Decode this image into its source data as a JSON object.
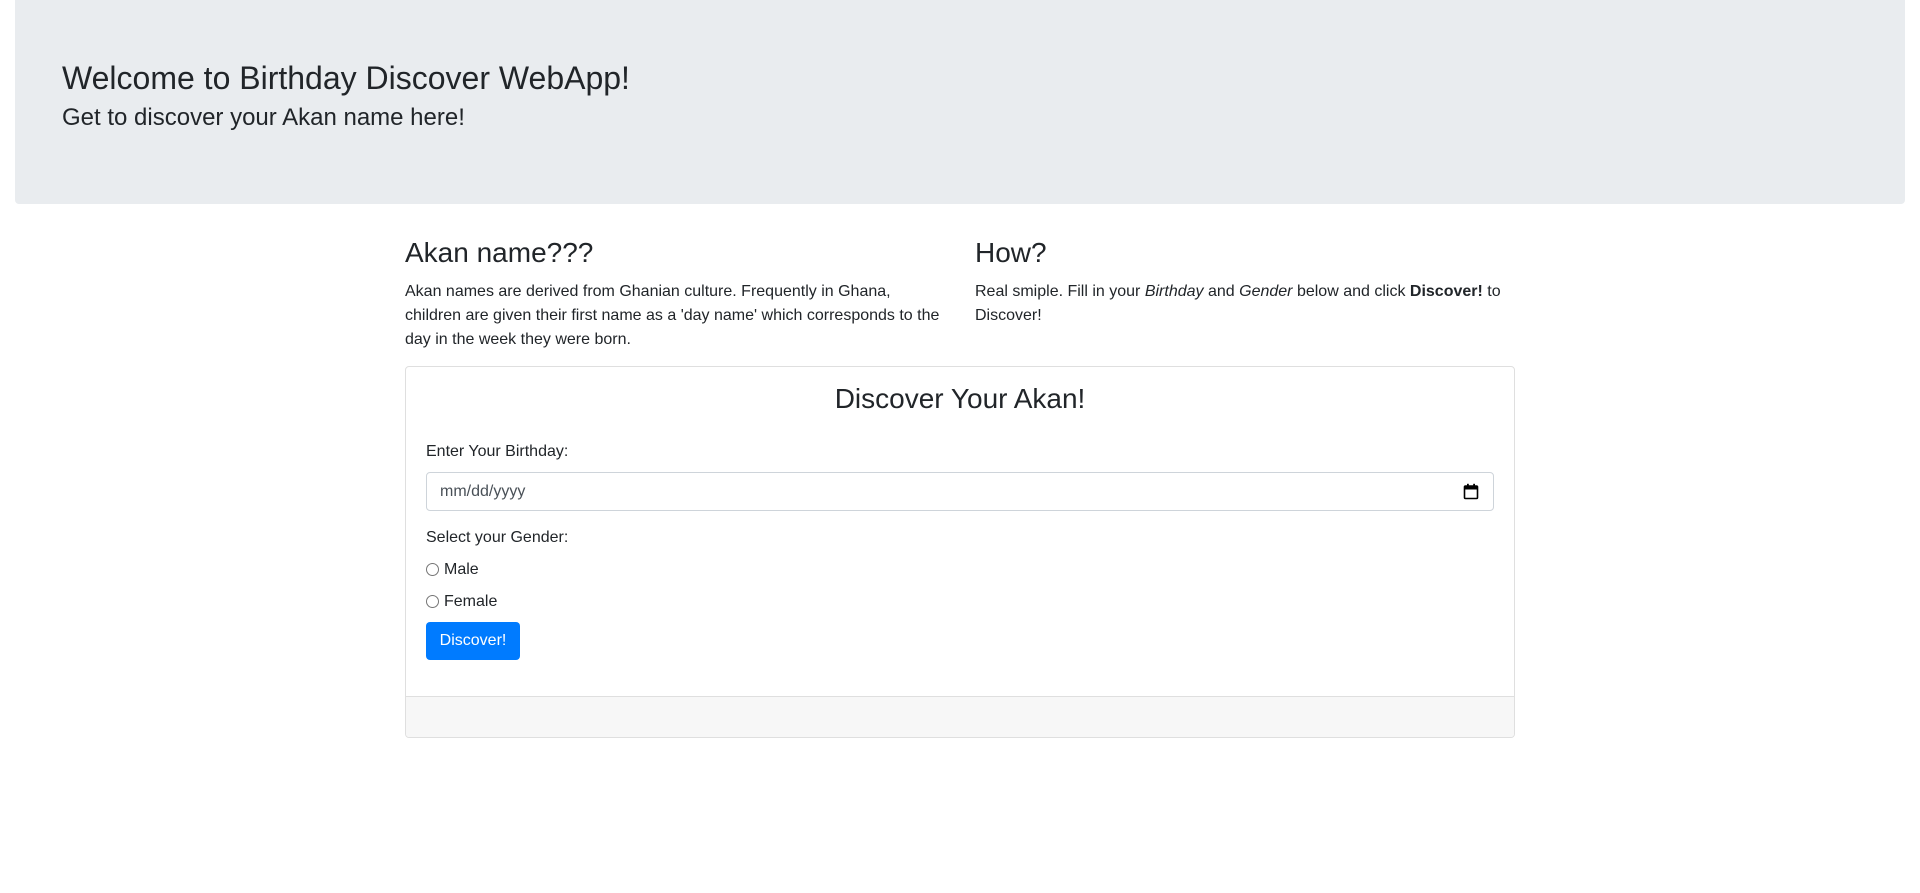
{
  "header": {
    "title": "Welcome to Birthday Discover WebApp!",
    "subtitle": "Get to discover your Akan name here!"
  },
  "intro": {
    "left": {
      "heading": "Akan name???",
      "text": "Akan names are derived from Ghanian culture. Frequently in Ghana, children are given their first name as a 'day name' which corresponds to the day in the week they were born."
    },
    "right": {
      "heading": "How?",
      "text_1": "Real smiple. Fill in your ",
      "birthday_em": "Birthday",
      "text_2": " and ",
      "gender_em": "Gender",
      "text_3": " below and click ",
      "discover_strong": "Discover!",
      "text_4": " to Discover!"
    }
  },
  "form": {
    "title": "Discover Your Akan!",
    "birthday_label": "Enter Your Birthday:",
    "birthday_placeholder": "mm/dd/yyyy",
    "gender_label": "Select your Gender:",
    "gender_options": [
      "Male",
      "Female"
    ],
    "submit_label": "Discover!",
    "accent_color": "#007bff"
  }
}
